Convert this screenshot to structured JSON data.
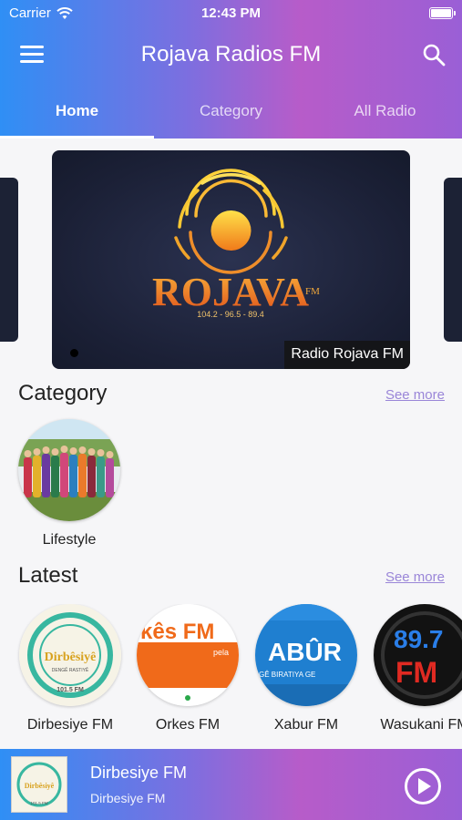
{
  "status_bar": {
    "carrier": "Carrier",
    "time": "12:43 PM"
  },
  "app_bar": {
    "title": "Rojava Radios FM",
    "menu_icon": "hamburger-menu-icon",
    "search_icon": "search-icon"
  },
  "tabs": [
    {
      "label": "Home",
      "active": true
    },
    {
      "label": "Category",
      "active": false
    },
    {
      "label": "All Radio",
      "active": false
    }
  ],
  "featured": {
    "caption": "Radio Rojava FM",
    "logo_text": "ROJAVA",
    "logo_fm": "FM",
    "logo_freqs": "104.2 - 96.5 - 89.4"
  },
  "category_section": {
    "title": "Category",
    "see_more": "See more",
    "items": [
      {
        "label": "Lifestyle"
      }
    ]
  },
  "latest_section": {
    "title": "Latest",
    "see_more": "See more",
    "items": [
      {
        "label": "Dirbesiye FM",
        "logo_text": "Dirbêsiyê",
        "logo_sub": "DENGÊ RASTIYÊ",
        "logo_freq": "101.5 FM"
      },
      {
        "label": "Orkes FM",
        "logo_text": "kês FM",
        "logo_sub": "pela"
      },
      {
        "label": "Xabur FM",
        "logo_text": "ABÛR",
        "logo_sub": "GÊ BIRATIYA GE"
      },
      {
        "label": "Wasukani FM",
        "logo_text": "89.7",
        "logo_sub": "FM"
      }
    ]
  },
  "player": {
    "title": "Dirbesiye FM",
    "subtitle": "Dirbesiye FM",
    "thumb_text": "Dirbêsiyê",
    "thumb_freq": "101.5 FM",
    "play_icon": "play-circle-icon"
  },
  "colors": {
    "gradient_start": "#2f8ff5",
    "gradient_mid": "#b75cc9",
    "gradient_end": "#9a5fd6",
    "link": "#9a86d8"
  }
}
